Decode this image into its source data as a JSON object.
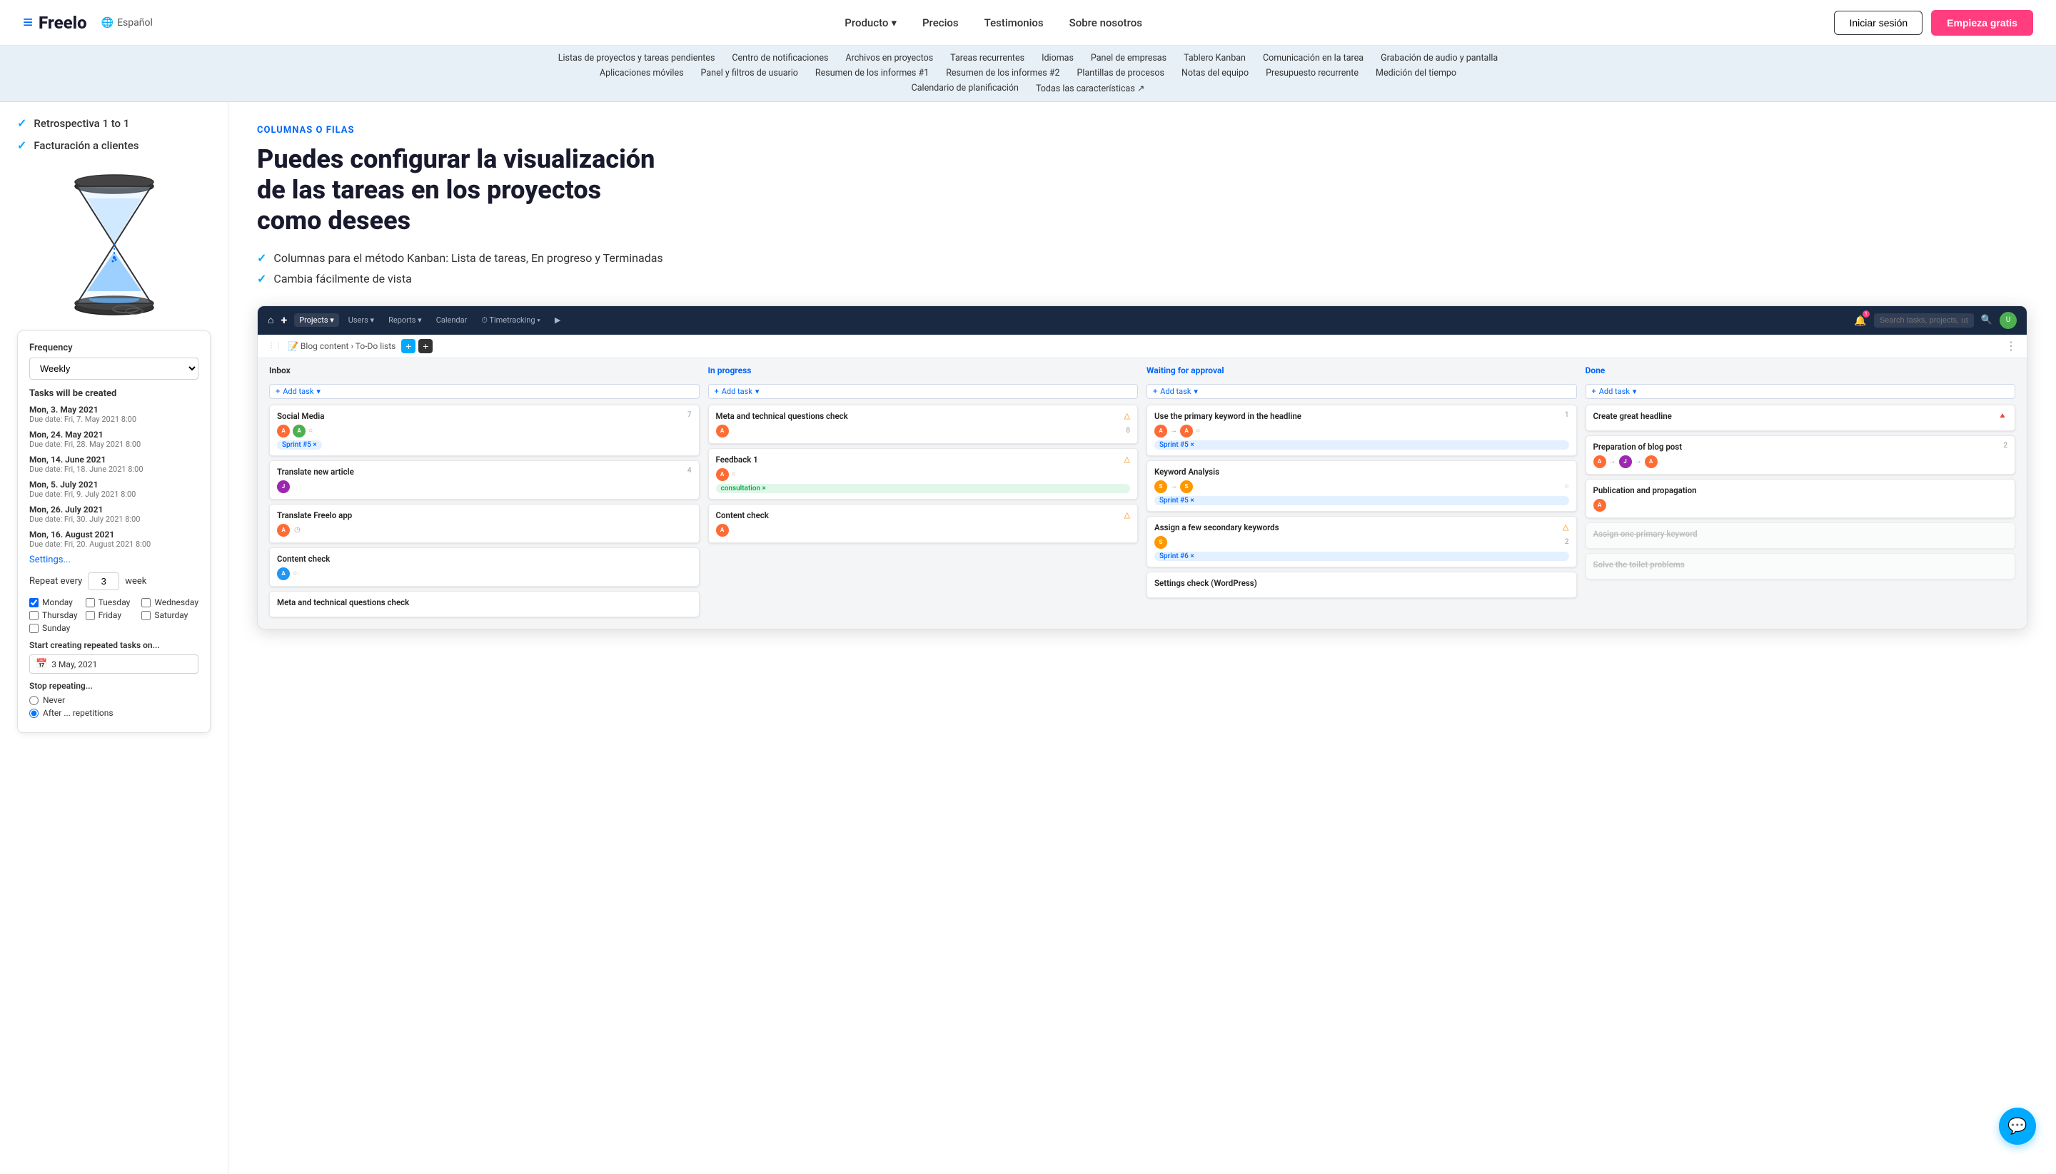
{
  "navbar": {
    "logo_text": "Freelo",
    "lang": "Español",
    "nav_items": [
      {
        "label": "Producto",
        "has_arrow": true
      },
      {
        "label": "Precios"
      },
      {
        "label": "Testimonios"
      },
      {
        "label": "Sobre nosotros"
      }
    ],
    "btn_login": "Iniciar sesión",
    "btn_start": "Empieza gratis"
  },
  "feature_nav": {
    "row1": [
      "Listas de proyectos y tareas pendientes",
      "Centro de notificaciones",
      "Archivos en proyectos",
      "Tareas recurrentes",
      "Idiomas",
      "Panel de empresas",
      "Tablero Kanban",
      "Comunicación en la tarea",
      "Grabación de audio y pantalla"
    ],
    "row2": [
      "Aplicaciones móviles",
      "Panel y filtros de usuario",
      "Resumen de los informes #1",
      "Resumen de los informes #2",
      "Plantillas de procesos",
      "Notas del equipo",
      "Presupuesto recurrente",
      "Medición del tiempo"
    ],
    "row3": [
      "Calendario de planificación",
      "Todas las características ↗"
    ]
  },
  "left_panel": {
    "check_items": [
      "Retrospectiva 1 to 1",
      "Facturación a clientes"
    ],
    "form": {
      "frequency_label": "Frequency",
      "frequency_value": "Weekly",
      "tasks_header": "Tasks will be created",
      "task_dates": [
        {
          "date": "Mon, 3. May 2021",
          "due": "Due date: Fri, 7. May 2021 8:00"
        },
        {
          "date": "Mon, 24. May 2021",
          "due": "Due date: Fri, 28. May 2021 8:00"
        },
        {
          "date": "Mon, 14. June 2021",
          "due": "Due date: Fri, 18. June 2021 8:00"
        },
        {
          "date": "Mon, 5. July 2021",
          "due": "Due date: Fri, 9. July 2021 8:00"
        },
        {
          "date": "Mon, 26. July 2021",
          "due": "Due date: Fri, 30. July 2021 8:00"
        },
        {
          "date": "Mon, 16. August 2021",
          "due": "Due date: Fri, 20. August 2021 8:00"
        }
      ],
      "settings_link": "Settings...",
      "repeat_label": "Repeat every",
      "repeat_value": "3",
      "repeat_unit": "week",
      "days": [
        {
          "label": "Monday",
          "checked": true
        },
        {
          "label": "Tuesday",
          "checked": false
        },
        {
          "label": "Wednesday",
          "checked": false
        },
        {
          "label": "Thursday",
          "checked": false
        },
        {
          "label": "Friday",
          "checked": false
        },
        {
          "label": "Saturday",
          "checked": false
        },
        {
          "label": "Sunday",
          "checked": false
        }
      ],
      "start_label": "Start creating repeated tasks on...",
      "start_date": "3 May, 2021",
      "stop_label": "Stop repeating...",
      "never_label": "Never",
      "after_label": "After ... repetitions"
    }
  },
  "right_panel": {
    "section_label": "COLUMNAS O FILAS",
    "section_title": "Puedes configurar la visualización de las tareas en los proyectos como desees",
    "features": [
      "Columnas para el método Kanban: Lista de tareas, En progreso y Terminadas",
      "Cambia fácilmente de vista"
    ]
  },
  "kanban": {
    "topbar": {
      "home_icon": "⌂",
      "plus_icon": "+",
      "nav_items": [
        "Projects ▾",
        "Users ▾",
        "Reports ▾",
        "Calendar",
        "⏱ Timetracking ▾",
        "▶"
      ],
      "search_placeholder": "Search tasks, projects, users...",
      "bell_badge": "1"
    },
    "breadcrumb": "📝 Blog content › To-Do lists",
    "columns": [
      {
        "title": "Inbox",
        "cards": [
          {
            "title": "Social Media",
            "num": "7",
            "avatars": [
              "Aug",
              "Aug"
            ],
            "tags": [
              "Sprint #5 ×"
            ],
            "alert": ""
          },
          {
            "title": "Translate new article",
            "num": "4",
            "avatars": [
              "Jun"
            ],
            "tags": [],
            "alert": ""
          },
          {
            "title": "Translate Freelo app",
            "num": "",
            "avatars": [
              "Aug"
            ],
            "tags": [],
            "alert": ""
          },
          {
            "title": "Content check",
            "num": "",
            "avatars": [],
            "tags": [],
            "alert": ""
          },
          {
            "title": "Meta and technical questions check",
            "num": "",
            "avatars": [],
            "tags": [],
            "alert": ""
          }
        ]
      },
      {
        "title": "In progress",
        "cards": [
          {
            "title": "Meta and technical questions check",
            "num": "8",
            "avatars": [
              "Aug"
            ],
            "tags": [],
            "alert": "△"
          },
          {
            "title": "Feedback 1",
            "num": "",
            "avatars": [
              "Aug"
            ],
            "tags": [
              "consultation ×"
            ],
            "alert": "△"
          },
          {
            "title": "Content check",
            "num": "",
            "avatars": [
              "Aug"
            ],
            "tags": [],
            "alert": "△"
          }
        ]
      },
      {
        "title": "Waiting for approval",
        "cards": [
          {
            "title": "Use the primary keyword in the headline",
            "num": "1",
            "avatars": [
              "Aug",
              "Aug"
            ],
            "tags": [
              "Sprint #5 ×"
            ],
            "alert": ""
          },
          {
            "title": "Keyword Analysis",
            "num": "",
            "avatars": [
              "Sep",
              "Sep"
            ],
            "tags": [
              "Sprint #5 ×"
            ],
            "alert": ""
          },
          {
            "title": "Assign a few secondary keywords",
            "num": "2",
            "avatars": [
              "Sep"
            ],
            "tags": [
              "Sprint #6 ×"
            ],
            "alert": "△"
          },
          {
            "title": "Settings check (WordPress)",
            "num": "",
            "avatars": [],
            "tags": [],
            "alert": ""
          }
        ]
      },
      {
        "title": "Done",
        "cards": [
          {
            "title": "Create great headline",
            "num": "",
            "avatars": [],
            "tags": [],
            "alert": "🔺",
            "strikethrough": false
          },
          {
            "title": "Preparation of blog post",
            "num": "2",
            "avatars": [
              "Aug",
              "Jun",
              "Aug"
            ],
            "tags": [],
            "alert": ""
          },
          {
            "title": "Publication and propagation",
            "num": "",
            "avatars": [
              "Aug"
            ],
            "tags": [],
            "alert": ""
          },
          {
            "title": "Assign one primary keyword",
            "num": "",
            "avatars": [],
            "tags": [],
            "alert": "",
            "strikethrough": true
          },
          {
            "title": "Solve the toilet problems",
            "num": "",
            "avatars": [],
            "tags": [],
            "alert": "",
            "strikethrough": true
          }
        ]
      }
    ]
  },
  "chat_btn_icon": "💬"
}
